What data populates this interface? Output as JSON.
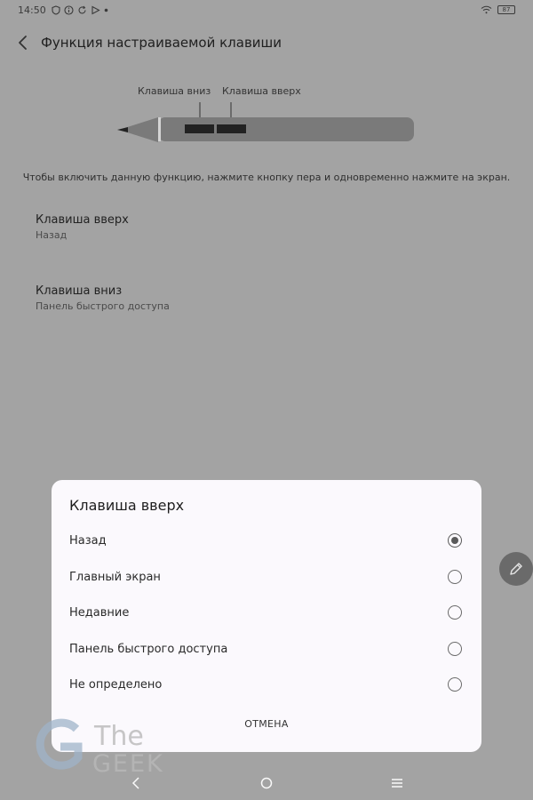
{
  "status_bar": {
    "time": "14:50",
    "battery": "87"
  },
  "header": {
    "title": "Функция настраиваемой клавиши"
  },
  "illustration": {
    "label_down": "Клавиша вниз",
    "label_up": "Клавиша вверх"
  },
  "instructions": "Чтобы включить данную функцию, нажмите кнопку пера и одновременно нажмите на экран.",
  "settings": [
    {
      "label": "Клавиша вверх",
      "value": "Назад"
    },
    {
      "label": "Клавиша вниз",
      "value": "Панель быстрого доступа"
    }
  ],
  "dialog": {
    "title": "Клавиша вверх",
    "options": [
      {
        "label": "Назад",
        "selected": true
      },
      {
        "label": "Главный экран",
        "selected": false
      },
      {
        "label": "Недавние",
        "selected": false
      },
      {
        "label": "Панель быстрого доступа",
        "selected": false
      },
      {
        "label": "Не определено",
        "selected": false
      }
    ],
    "cancel_label": "ОТМЕНА"
  },
  "watermark": {
    "line1": "The",
    "line2": "GEEK"
  },
  "colors": {
    "scrim": "#a3a3a3",
    "dialog_bg": "#fbf9fd",
    "pen_body": "#7a7a7a",
    "fab_bg": "#6a6a6a"
  },
  "icons": {
    "back": "chevron-left-icon",
    "fab": "pen-icon",
    "nav_back": "nav-back-icon",
    "nav_home": "nav-home-icon",
    "nav_menu": "nav-menu-icon"
  }
}
